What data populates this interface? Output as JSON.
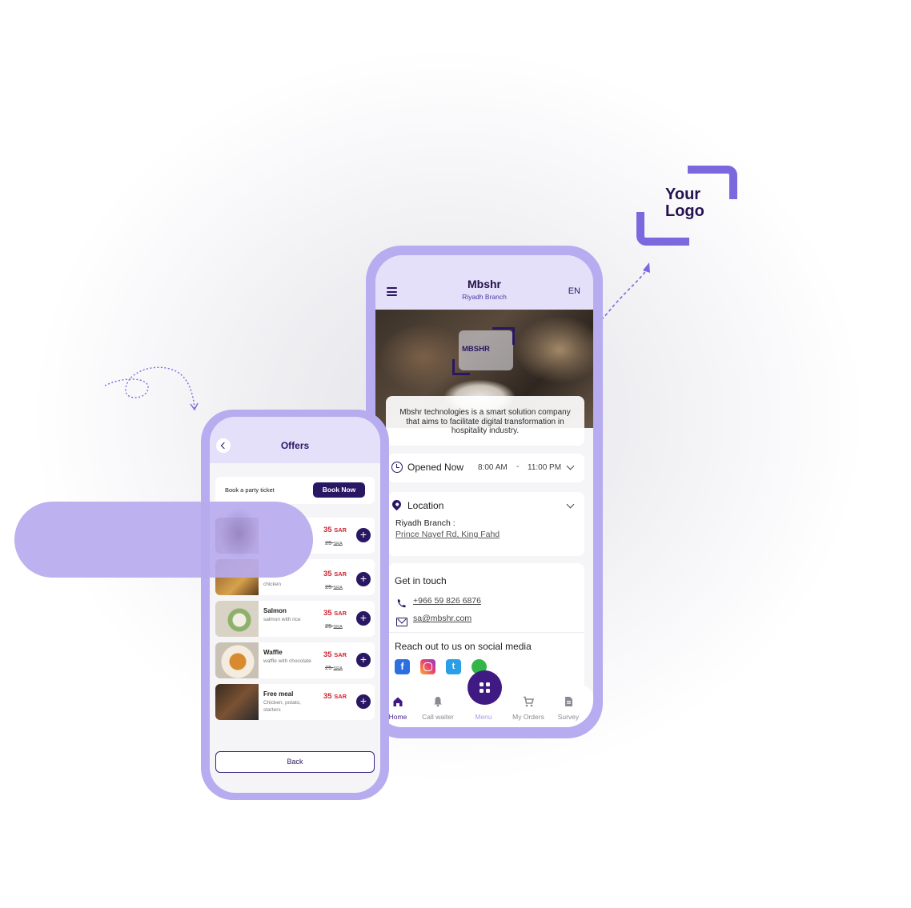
{
  "logo": {
    "line1": "Your",
    "line2": "Logo"
  },
  "main_app": {
    "title": "Mbshr",
    "subtitle": "Riyadh Branch",
    "language": "EN",
    "hero_badge": "MBSHR",
    "about": "Mbshr technologies is a smart solution company that aims to facilitate digital transformation in hospitality industry.",
    "hours": {
      "label": "Opened Now",
      "open": "8:00 AM",
      "separator": "-",
      "close": "11:00 PM"
    },
    "location": {
      "label": "Location",
      "branch": "Riyadh Branch :",
      "address": "Prince Nayef Rd, King Fahd"
    },
    "contact": {
      "heading": "Get in touch",
      "phone": "+966 59 826 6876",
      "email": "sa@mbshr.com",
      "social_heading": "Reach out to us on social media",
      "social_icons": [
        "facebook-icon",
        "instagram-icon",
        "twitter-icon",
        "whatsapp-icon"
      ]
    },
    "nav": {
      "home": "Home",
      "call_waiter": "Call waiter",
      "menu": "Menu",
      "my_orders": "My Orders",
      "survey": "Survey"
    }
  },
  "offers_app": {
    "title": "Offers",
    "party_text": "Book a party ticket",
    "book_now": "Book Now",
    "currency_old": "SRA",
    "items": [
      {
        "name": "",
        "desc": "",
        "price": "35",
        "currency": "SAR",
        "old_price": "25"
      },
      {
        "name": "",
        "desc": "chicken",
        "price": "35",
        "currency": "SAR",
        "old_price": "25"
      },
      {
        "name": "Salmon",
        "desc": "salmon with rice",
        "price": "35",
        "currency": "SAR",
        "old_price": "25"
      },
      {
        "name": "Waffle",
        "desc": "waffle with chocolate",
        "price": "35",
        "currency": "SAR",
        "old_price": "25"
      },
      {
        "name": "Free meal",
        "desc": "Chicken, potato, starters",
        "price": "35",
        "currency": "SAR",
        "old_price": ""
      }
    ],
    "back": "Back"
  },
  "colors": {
    "brand_dark": "#2a1763",
    "brand_light": "#e5e0fa",
    "frame": "#b6acef",
    "accent": "#7b68de",
    "price_red": "#d0242f"
  }
}
